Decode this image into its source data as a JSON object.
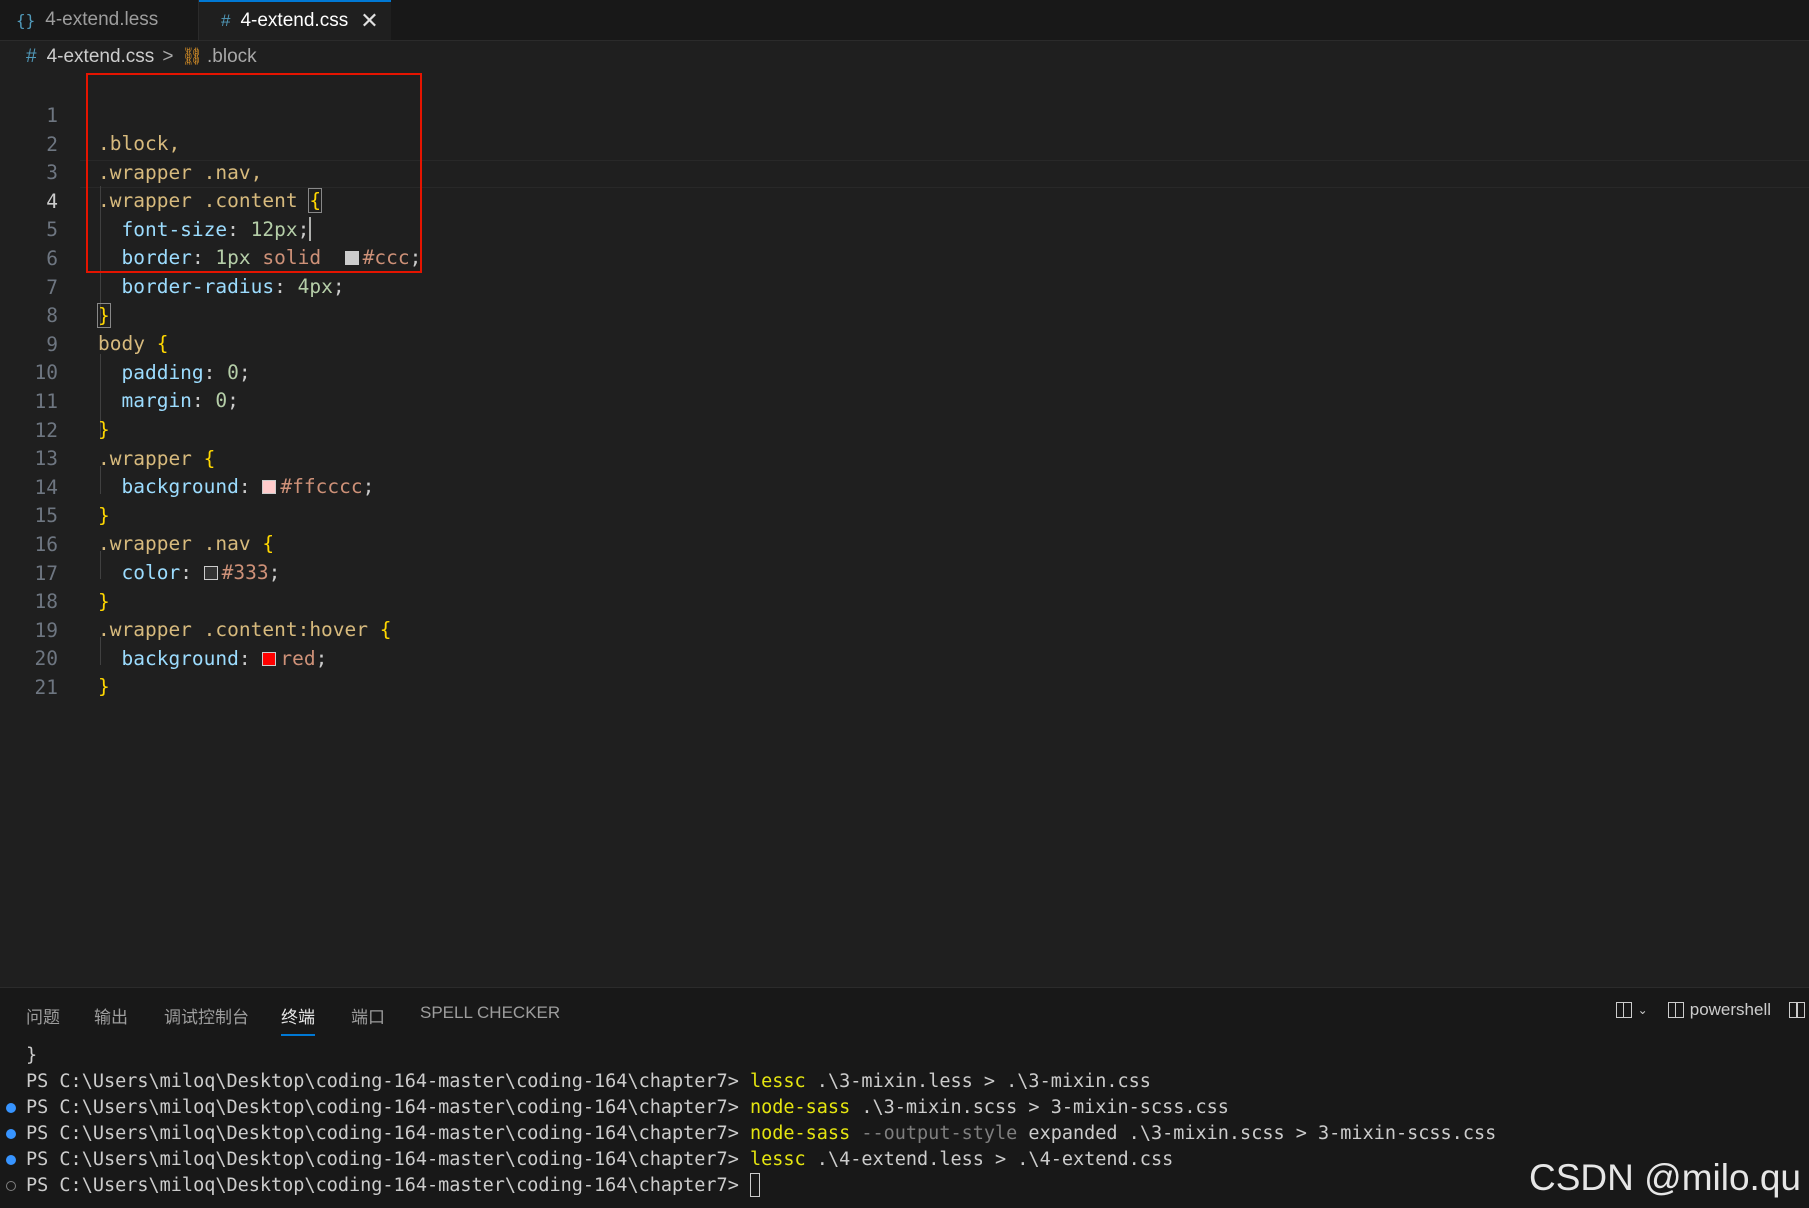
{
  "tabs": [
    {
      "icon": "{}",
      "label": "4-extend.less"
    },
    {
      "icon": "#",
      "label": "4-extend.css",
      "close": "✕"
    }
  ],
  "breadcrumb": {
    "icon": "#",
    "file": "4-extend.css",
    "separator": ">",
    "symbol_icon": "⛓",
    "symbol": ".block"
  },
  "editor": {
    "line_numbers": [
      "1",
      "2",
      "3",
      "4",
      "5",
      "6",
      "7",
      "8",
      "9",
      "10",
      "11",
      "12",
      "13",
      "14",
      "15",
      "16",
      "17",
      "18",
      "19",
      "20",
      "21"
    ],
    "active_line": 4,
    "lines": {
      "l1": ".block,",
      "l2": ".wrapper .nav,",
      "l3_sel": ".wrapper .content ",
      "l3_brace": "{",
      "l4_prop": "font-size",
      "l4_val": "12px",
      "l5_prop": "border",
      "l5_num": "1px",
      "l5_kw": "solid",
      "l5_hex": "#ccc",
      "l6_prop": "border-radius",
      "l6_val": "4px",
      "l7_brace": "}",
      "l8_tag": "body ",
      "l8_brace": "{",
      "l9_prop": "padding",
      "l9_val": "0",
      "l10_prop": "margin",
      "l10_val": "0",
      "l11_brace": "}",
      "l12_sel": ".wrapper ",
      "l12_brace": "{",
      "l13_prop": "background",
      "l13_hex": "#ffcccc",
      "l14_brace": "}",
      "l15_sel": ".wrapper .nav ",
      "l15_brace": "{",
      "l16_prop": "color",
      "l16_hex": "#333",
      "l17_brace": "}",
      "l18_sel": ".wrapper .content:hover ",
      "l18_brace": "{",
      "l19_prop": "background",
      "l19_kw": "red",
      "l20_brace": "}"
    },
    "swatch_colors": {
      "ccc": "#cccccc",
      "ffcccc": "#ffcccc",
      "c333": "#333333",
      "red": "#ff0000"
    }
  },
  "panel": {
    "tabs": [
      "问题",
      "输出",
      "调试控制台",
      "终端",
      "端口",
      "SPELL CHECKER"
    ],
    "active_tab": "终端",
    "shell_label": "powershell"
  },
  "terminal": {
    "line0": "}",
    "prompt": "PS C:\\Users\\miloq\\Desktop\\coding-164-master\\coding-164\\chapter7> ",
    "cmd1": "lessc",
    "args1": " .\\3-mixin.less > .\\3-mixin.css",
    "cmd2": "node-sass",
    "args2": " .\\3-mixin.scss > 3-mixin-scss.css",
    "cmd3": "node-sass",
    "flag3": " --output-style",
    "args3": " expanded .\\3-mixin.scss > 3-mixin-scss.css",
    "cmd4": "lessc",
    "args4": " .\\4-extend.less > .\\4-extend.css"
  },
  "watermark": "CSDN @milo.qu"
}
